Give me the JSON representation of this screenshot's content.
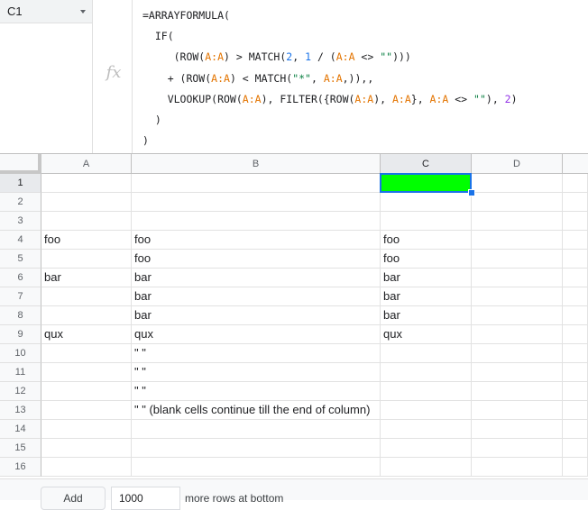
{
  "name_box": {
    "value": "C1"
  },
  "fx_label": "fx",
  "formula_lines": [
    [
      {
        "t": "=ARRAYFORMULA("
      }
    ],
    [
      {
        "t": "  IF("
      }
    ],
    [
      {
        "t": "     (ROW("
      },
      {
        "t": "A:A",
        "c": "ref"
      },
      {
        "t": ") > MATCH("
      },
      {
        "t": "2",
        "c": "num"
      },
      {
        "t": ", "
      },
      {
        "t": "1",
        "c": "num"
      },
      {
        "t": " / ("
      },
      {
        "t": "A:A",
        "c": "ref"
      },
      {
        "t": " <> "
      },
      {
        "t": "\"\"",
        "c": "str"
      },
      {
        "t": ")))"
      }
    ],
    [
      {
        "t": "    + (ROW("
      },
      {
        "t": "A:A",
        "c": "ref"
      },
      {
        "t": ") < MATCH("
      },
      {
        "t": "\"*\"",
        "c": "str"
      },
      {
        "t": ", "
      },
      {
        "t": "A:A",
        "c": "ref"
      },
      {
        "t": ",)),,"
      }
    ],
    [
      {
        "t": "    VLOOKUP(ROW("
      },
      {
        "t": "A:A",
        "c": "ref"
      },
      {
        "t": "), FILTER({ROW("
      },
      {
        "t": "A:A",
        "c": "ref"
      },
      {
        "t": "), "
      },
      {
        "t": "A:A",
        "c": "ref"
      },
      {
        "t": "}, "
      },
      {
        "t": "A:A",
        "c": "ref"
      },
      {
        "t": " <> "
      },
      {
        "t": "\"\"",
        "c": "str"
      },
      {
        "t": "), "
      },
      {
        "t": "2",
        "c": "num2"
      },
      {
        "t": ")"
      }
    ],
    [
      {
        "t": "  )"
      }
    ],
    [
      {
        "t": ")"
      }
    ]
  ],
  "columns": [
    "A",
    "B",
    "C",
    "D"
  ],
  "selected_column": "C",
  "selected_cell": "C1",
  "selected_cell_color": "#00ff00",
  "rows": [
    {
      "num": "1",
      "cells": [
        "",
        "",
        ""
      ]
    },
    {
      "num": "2",
      "cells": [
        "",
        "",
        ""
      ]
    },
    {
      "num": "3",
      "cells": [
        "",
        "",
        ""
      ]
    },
    {
      "num": "4",
      "cells": [
        "foo",
        "foo",
        "foo"
      ]
    },
    {
      "num": "5",
      "cells": [
        "",
        "foo",
        "foo"
      ]
    },
    {
      "num": "6",
      "cells": [
        "bar",
        "bar",
        "bar"
      ]
    },
    {
      "num": "7",
      "cells": [
        "",
        "bar",
        "bar"
      ]
    },
    {
      "num": "8",
      "cells": [
        "",
        "bar",
        "bar"
      ]
    },
    {
      "num": "9",
      "cells": [
        "qux",
        "qux",
        "qux"
      ]
    },
    {
      "num": "10",
      "cells": [
        "",
        "\" \"",
        ""
      ]
    },
    {
      "num": "11",
      "cells": [
        "",
        "\" \"",
        ""
      ]
    },
    {
      "num": "12",
      "cells": [
        "",
        "\" \"",
        ""
      ]
    },
    {
      "num": "13",
      "cells": [
        "",
        "\" \" (blank cells continue till the end of column)",
        ""
      ]
    },
    {
      "num": "14",
      "cells": [
        "",
        "",
        ""
      ]
    },
    {
      "num": "15",
      "cells": [
        "",
        "",
        ""
      ]
    },
    {
      "num": "16",
      "cells": [
        "",
        "",
        ""
      ]
    }
  ],
  "bottom_bar": {
    "add_label": "Add",
    "rows_value": "1000",
    "more_rows_label": "more rows at bottom"
  }
}
